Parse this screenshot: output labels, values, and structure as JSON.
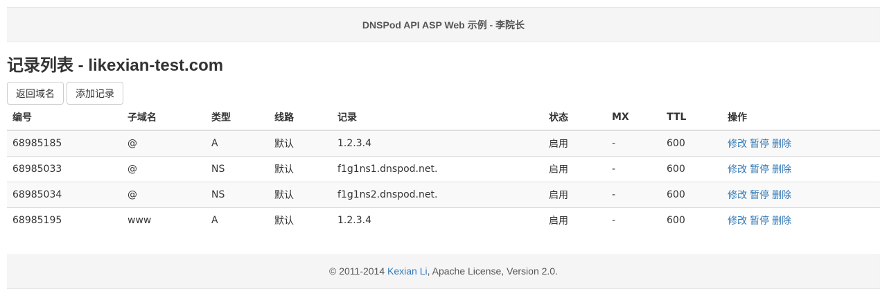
{
  "header": {
    "title": "DNSPod API ASP Web 示例 - 李院长"
  },
  "page": {
    "title": "记录列表 - likexian-test.com"
  },
  "toolbar": {
    "back_label": "返回域名",
    "add_label": "添加记录"
  },
  "table": {
    "columns": [
      "编号",
      "子域名",
      "类型",
      "线路",
      "记录",
      "状态",
      "MX",
      "TTL",
      "操作"
    ],
    "rows": [
      {
        "id": "68985185",
        "sub": "@",
        "type": "A",
        "line": "默认",
        "value": "1.2.3.4",
        "status": "启用",
        "mx": "-",
        "ttl": "600"
      },
      {
        "id": "68985033",
        "sub": "@",
        "type": "NS",
        "line": "默认",
        "value": "f1g1ns1.dnspod.net.",
        "status": "启用",
        "mx": "-",
        "ttl": "600"
      },
      {
        "id": "68985034",
        "sub": "@",
        "type": "NS",
        "line": "默认",
        "value": "f1g1ns2.dnspod.net.",
        "status": "启用",
        "mx": "-",
        "ttl": "600"
      },
      {
        "id": "68985195",
        "sub": "www",
        "type": "A",
        "line": "默认",
        "value": "1.2.3.4",
        "status": "启用",
        "mx": "-",
        "ttl": "600"
      }
    ],
    "actions": {
      "edit": "修改",
      "pause": "暂停",
      "delete": "删除"
    }
  },
  "footer": {
    "prefix": "© 2011-2014 ",
    "author_link": "Kexian Li",
    "suffix": ", Apache License, Version 2.0."
  },
  "colors": {
    "link": "#337ab7",
    "bar_bg": "#f5f5f5",
    "stripe": "#f9f9f9"
  }
}
